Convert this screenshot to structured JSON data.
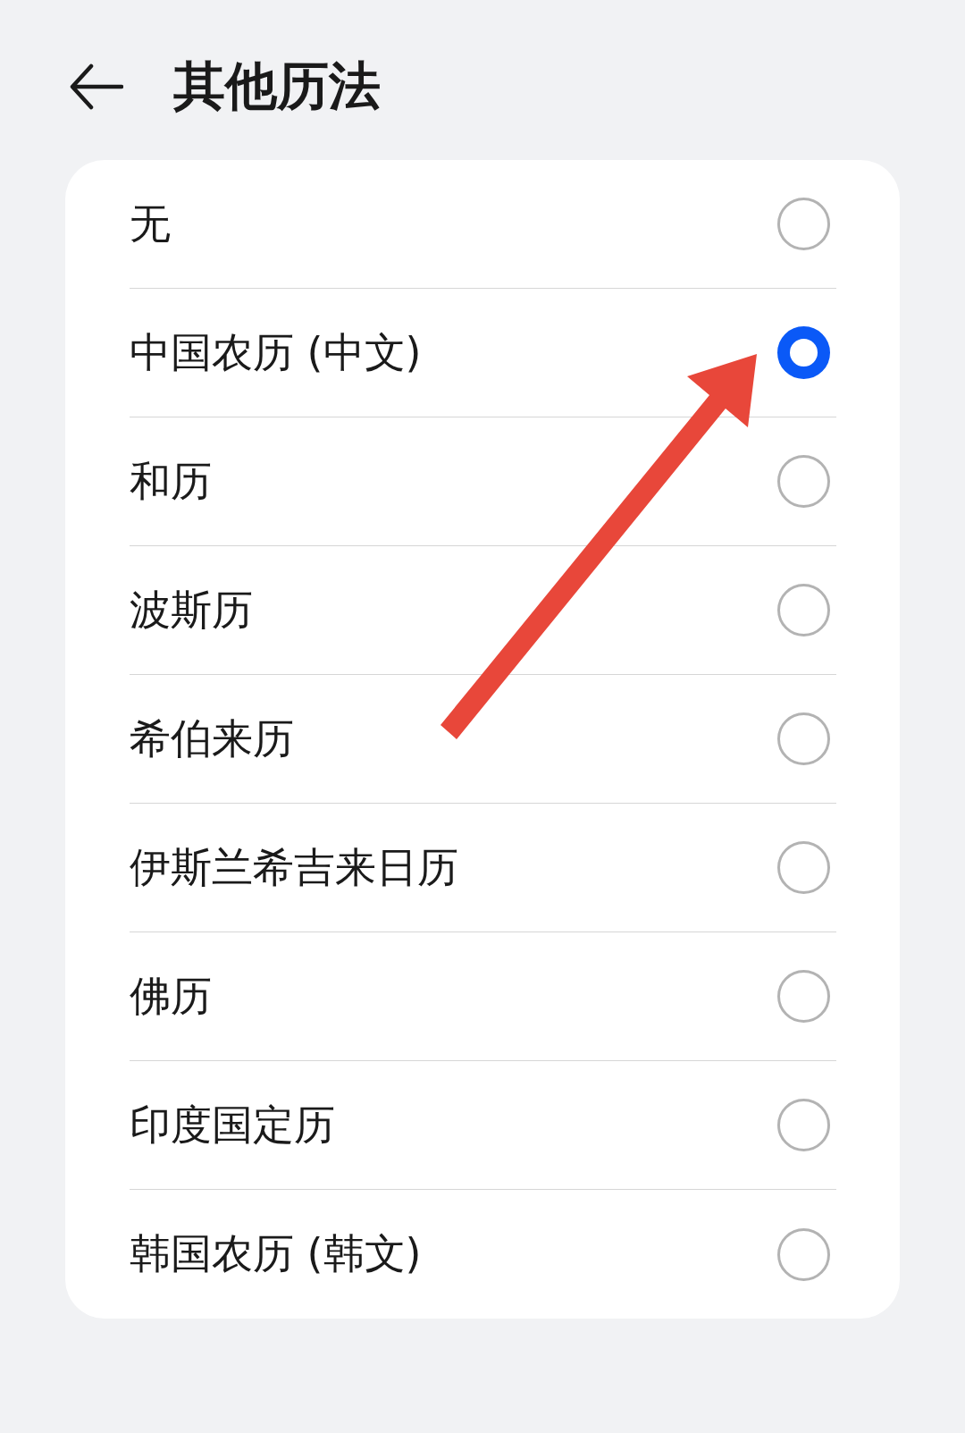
{
  "header": {
    "title": "其他历法"
  },
  "options": [
    {
      "label": "无",
      "selected": false
    },
    {
      "label": "中国农历 (中文)",
      "selected": true
    },
    {
      "label": "和历",
      "selected": false
    },
    {
      "label": "波斯历",
      "selected": false
    },
    {
      "label": "希伯来历",
      "selected": false
    },
    {
      "label": "伊斯兰希吉来日历",
      "selected": false
    },
    {
      "label": "佛历",
      "selected": false
    },
    {
      "label": "印度国定历",
      "selected": false
    },
    {
      "label": "韩国农历 (韩文)",
      "selected": false
    }
  ]
}
